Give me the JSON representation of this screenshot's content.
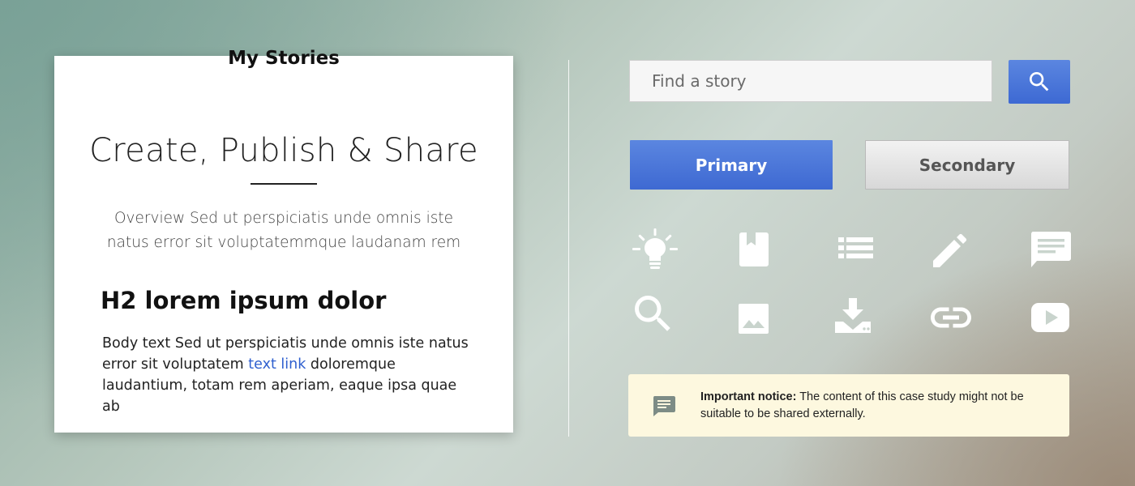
{
  "card": {
    "title": "My Stories",
    "subtitle": "Create, Publish & Share",
    "overview": "Overview Sed ut perspiciatis unde omnis iste natus error sit voluptatemmque laudanam rem",
    "h2": "H2 lorem ipsum dolor",
    "body_before_link": "Body text Sed ut perspiciatis unde omnis iste natus error sit voluptatem ",
    "link_text": "text link",
    "body_after_link": " doloremque laudantium, totam rem aperiam, eaque ipsa quae ab"
  },
  "search": {
    "placeholder": "Find a story",
    "button_icon": "search-icon"
  },
  "buttons": {
    "primary_label": "Primary",
    "secondary_label": "Secondary"
  },
  "icons": [
    "lightbulb-icon",
    "bookmark-icon",
    "list-icon",
    "pencil-icon",
    "comment-icon",
    "search-icon",
    "image-icon",
    "download-icon",
    "link-icon",
    "video-play-icon"
  ],
  "notice": {
    "icon": "comment-icon",
    "label": "Important notice:",
    "text": " The content of this case study might not be suitable to be shared externally."
  },
  "colors": {
    "accent": "#4a76da",
    "notice_bg": "#fdf8df",
    "link": "#2e5fcf"
  }
}
